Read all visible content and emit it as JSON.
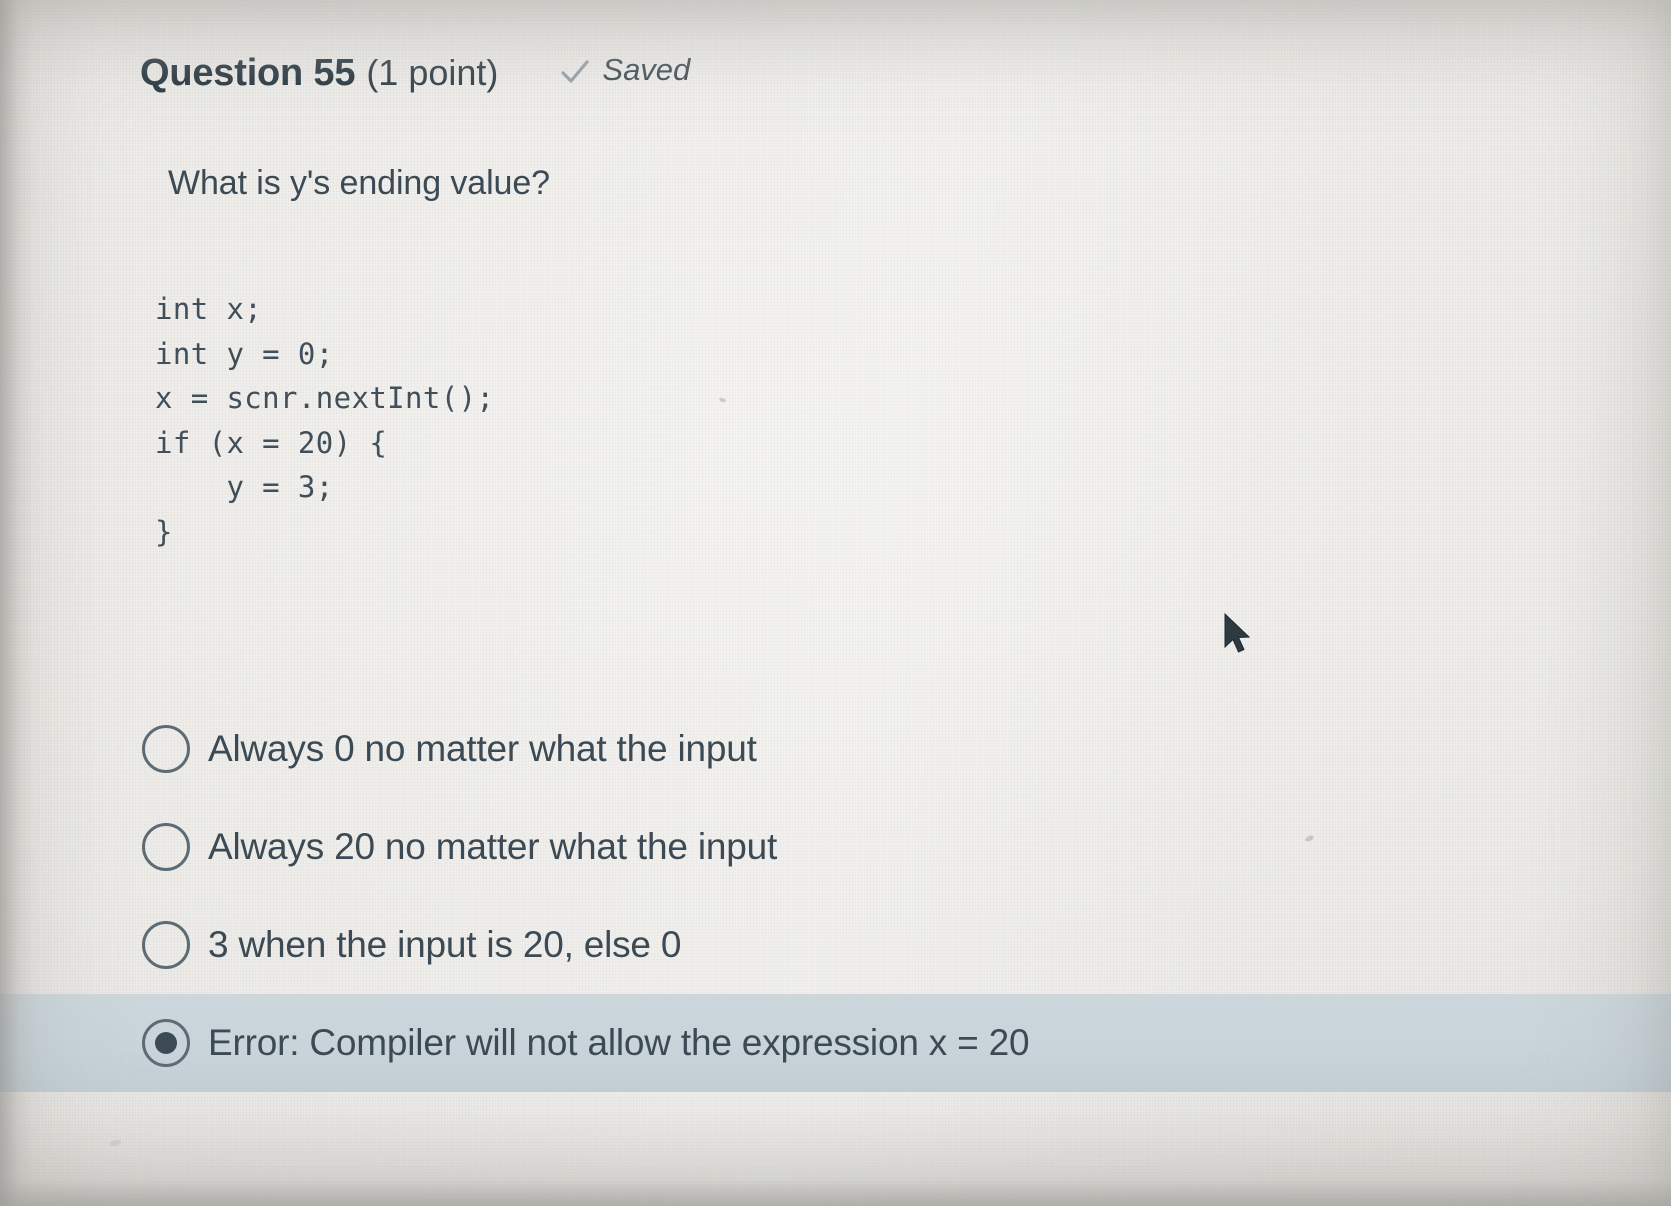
{
  "header": {
    "question_title": "Question 55",
    "points": "(1 point)",
    "saved_icon": "check-icon",
    "saved_label": "Saved"
  },
  "question": {
    "prompt": "What is y's ending value?",
    "code": "int x;\nint y = 0;\nx = scnr.nextInt();\nif (x = 20) {\n    y = 3;\n}"
  },
  "options": [
    {
      "label": "Always 0 no matter what the input",
      "selected": false
    },
    {
      "label": "Always 20 no matter what the input",
      "selected": false
    },
    {
      "label": "3 when the input is 20, else 0",
      "selected": false
    },
    {
      "label": "Error: Compiler will not allow the expression x = 20",
      "selected": true
    }
  ],
  "colors": {
    "text": "#3b4a54",
    "selected_row_background": "#c9d4da",
    "screen_background": "#eceae6",
    "check_icon": "#9aa6ad"
  }
}
